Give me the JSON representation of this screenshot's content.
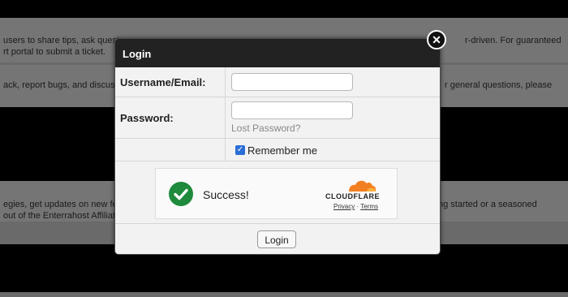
{
  "background": {
    "lines": [
      "users to share tips, ask quest",
      "r-driven. For guaranteed",
      "rt portal to submit a ticket.",
      "ack, report bugs, and discuss",
      "r general questions, please",
      "egies, get updates on new fe",
      "ng started or a seasoned",
      "out of the Enterrahost Affiliat"
    ]
  },
  "modal": {
    "title": "Login",
    "username_label": "Username/Email:",
    "username_value": "",
    "password_label": "Password:",
    "password_value": "",
    "lost_password": "Lost Password?",
    "remember_label": "Remember me",
    "remember_checked": true,
    "captcha": {
      "status_text": "Success!",
      "brand": "CLOUDFLARE",
      "privacy": "Privacy",
      "separator": "·",
      "terms": "Terms"
    },
    "login_button": "Login",
    "close_icon": "close-icon"
  }
}
